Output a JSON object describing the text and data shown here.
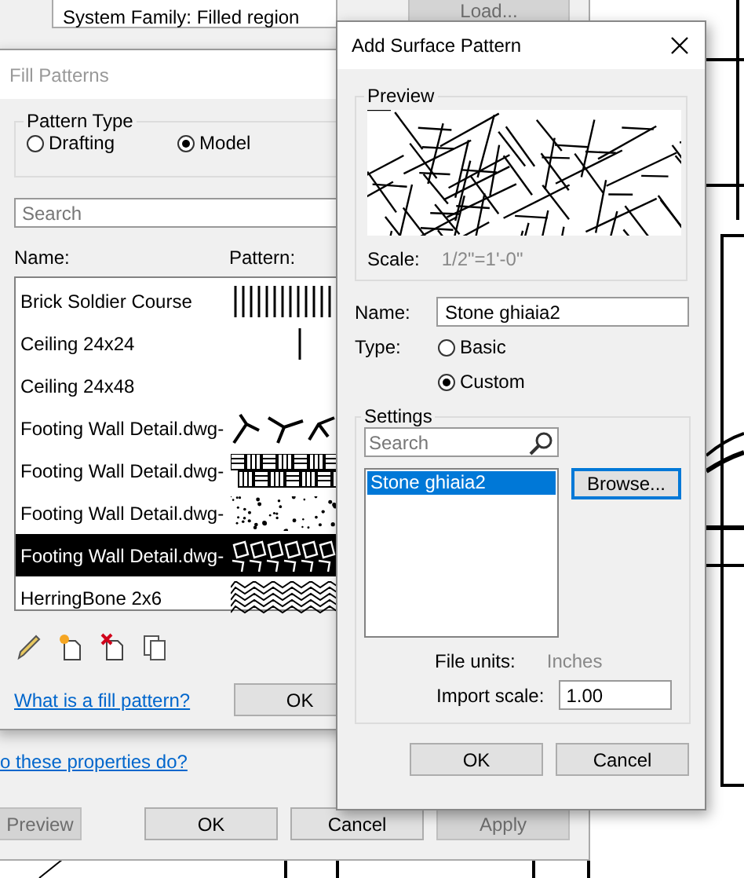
{
  "background_dialog": {
    "family_field": "System Family: Filled region",
    "load_button": {
      "label": "Load...",
      "disabled": true
    },
    "help_link": "o these properties do?",
    "buttons": [
      {
        "label": "Preview",
        "disabled": true
      },
      {
        "label": "OK",
        "disabled": false
      },
      {
        "label": "Cancel",
        "disabled": false
      },
      {
        "label": "Apply",
        "disabled": true
      }
    ]
  },
  "fill_patterns_dialog": {
    "title": "Fill Patterns",
    "active": false,
    "pattern_type": {
      "label": "Pattern Type",
      "options": [
        {
          "label": "Drafting",
          "selected": false
        },
        {
          "label": "Model",
          "selected": true
        }
      ]
    },
    "search": {
      "placeholder": "Search"
    },
    "columns": [
      "Name:",
      "Pattern:"
    ],
    "rows": [
      {
        "name": "Brick Soldier Course",
        "kind": "soldier",
        "selected": false
      },
      {
        "name": "Ceiling 24x24",
        "kind": "single-line",
        "selected": false
      },
      {
        "name": "Ceiling 24x48",
        "kind": "blank",
        "selected": false
      },
      {
        "name": "Footing Wall Detail.dwg-",
        "kind": "cracks",
        "selected": false
      },
      {
        "name": "Footing Wall Detail.dwg-",
        "kind": "basketweave",
        "selected": false
      },
      {
        "name": "Footing Wall Detail.dwg-",
        "kind": "dots",
        "selected": false
      },
      {
        "name": "Footing Wall Detail.dwg-",
        "kind": "stones",
        "selected": true
      },
      {
        "name": "HerringBone 2x6",
        "kind": "herringbone",
        "selected": false
      }
    ],
    "help_link": "What is a fill pattern?",
    "ok_button": "OK"
  },
  "add_surface_pattern_dialog": {
    "title": "Add Surface Pattern",
    "preview": {
      "label": "Preview",
      "scale_label": "Scale:",
      "scale_value": "1/2\"=1'-0\""
    },
    "name": {
      "label": "Name:",
      "value": "Stone ghiaia2"
    },
    "type": {
      "label": "Type:",
      "options": [
        {
          "label": "Basic",
          "selected": false
        },
        {
          "label": "Custom",
          "selected": true
        }
      ]
    },
    "settings": {
      "label": "Settings",
      "search": {
        "placeholder": "Search"
      },
      "items": [
        {
          "label": "Stone ghiaia2",
          "selected": true
        }
      ],
      "browse_button": "Browse...",
      "file_units_label": "File units:",
      "file_units_value": "Inches",
      "import_scale_label": "Import scale:",
      "import_scale_value": "1.00"
    },
    "buttons": [
      "OK",
      "Cancel"
    ]
  }
}
